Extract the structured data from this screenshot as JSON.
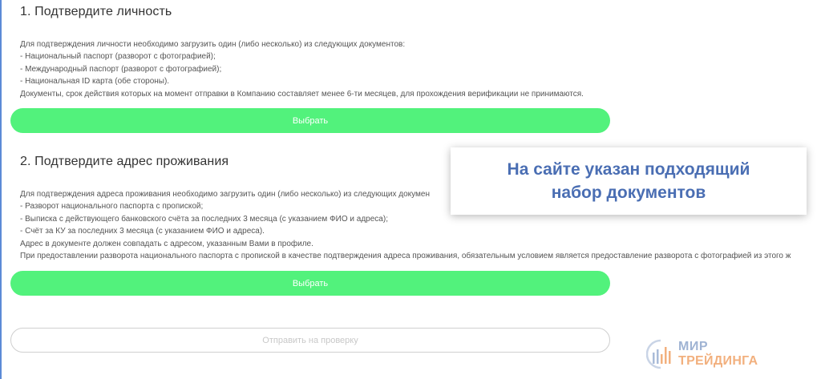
{
  "section1": {
    "title": "1. Подтвердите личность",
    "lines": [
      "Для подтверждения личности необходимо загрузить один (либо несколько) из следующих документов:",
      "- Национальный паспорт (разворот с фотографией);",
      "- Международный паспорт (разворот с фотографией);",
      "- Национальная ID карта (обе стороны).",
      "Документы, срок действия которых на момент отправки в Компанию составляет менее 6-ти месяцев, для прохождения верификации не принимаются."
    ],
    "button_label": "Выбрать"
  },
  "section2": {
    "title": "2. Подтвердите адрес проживания",
    "lines": [
      "Для подтверждения адреса проживания необходимо загрузить один (либо несколько) из следующих докумен",
      "- Разворот национального паспорта с пропиской;",
      "- Выписка с действующего банковского счёта за последних 3 месяца (с указанием ФИО и адреса);",
      "- Счёт за КУ за последних 3 месяца (с указанием ФИО и адреса).",
      "Адрес в документе должен совпадать с адресом, указанным Вами в профиле.",
      "При предоставлении разворота национального паспорта с пропиской в качестве подтверждения адреса проживания, обязательным условием является предоставление разворота с фотографией из этого ж"
    ],
    "button_label": "Выбрать"
  },
  "submit_button_label": "Отправить на проверку",
  "callout": {
    "line1": "На сайте указан подходящий",
    "line2": "набор документов"
  },
  "watermark": {
    "top": "МИР",
    "bottom": "ТРЕЙДИНГА"
  },
  "colors": {
    "button_green": "#52f27c",
    "callout_text": "#4a6eb3",
    "logo_blue": "#9fb3d3",
    "logo_orange": "#f2b07e"
  }
}
